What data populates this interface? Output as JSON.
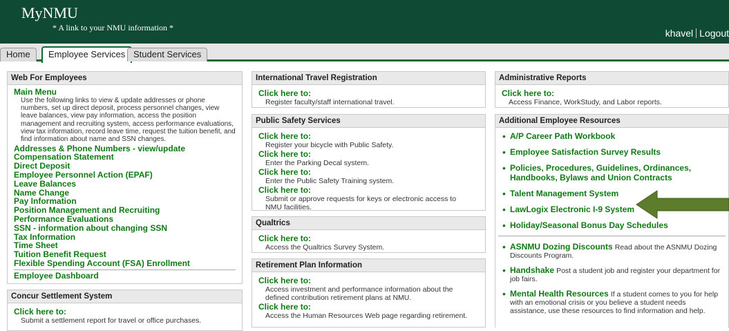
{
  "header": {
    "logo": "MyNMU",
    "tagline": "* A link to your NMU information *",
    "username": "khavel",
    "logout": "Logout"
  },
  "tabs": [
    {
      "label": "Home"
    },
    {
      "label": "Employee Services"
    },
    {
      "label": "Student Services"
    }
  ],
  "web_employees": {
    "title": "Web For Employees",
    "main_menu": "Main Menu",
    "main_menu_desc": "Use the following links to view & update addresses or phone numbers, set up direct deposit, process personnel changes, view leave balances, view pay information, access the position management and recruiting system, access performance evaluations, view tax information, record leave time, request the tuition benefit, and find information about name and SSN changes.",
    "links": [
      "Addresses & Phone Numbers - view/update",
      "Compensation Statement",
      "Direct Deposit",
      "Employee Personnel Action (EPAF)",
      "Leave Balances",
      "Name Change",
      "Pay Information",
      "Position Management and Recruiting",
      "Performance Evaluations",
      "SSN - information about changing SSN",
      "Tax Information",
      "Time Sheet",
      "Tuition Benefit Request",
      "Flexible Spending Account (FSA) Enrollment"
    ],
    "dashboard": "Employee Dashboard"
  },
  "concur": {
    "title": "Concur Settlement System",
    "link": "Click here to:",
    "desc": "Submit a settlement report for travel or office purchases."
  },
  "travel": {
    "title": "International Travel Registration",
    "link": "Click here to:",
    "desc": "Register faculty/staff international travel."
  },
  "safety": {
    "title": "Public Safety Services",
    "items": [
      {
        "link": "Click here to:",
        "desc": "Register your bicycle with Public Safety."
      },
      {
        "link": "Click here to:",
        "desc": "Enter the Parking Decal system."
      },
      {
        "link": "Click here to:",
        "desc": "Enter the Public Safety Training system."
      },
      {
        "link": "Click here to:",
        "desc": "Submit or approve requests for keys or electronic access to NMU facilities."
      }
    ]
  },
  "qualtrics": {
    "title": "Qualtrics",
    "link": "Click here to:",
    "desc": "Access the Qualtrics Survey System."
  },
  "retirement": {
    "title": "Retirement Plan Information",
    "items": [
      {
        "link": "Click here to:",
        "desc": "Access investment and performance information about the defined contribution retirement plans at NMU."
      },
      {
        "link": "Click here to:",
        "desc": "Access the Human Resources Web page regarding retirement."
      }
    ]
  },
  "admin": {
    "title": "Administrative Reports",
    "link": "Click here to:",
    "desc": "Access Finance, WorkStudy, and Labor reports."
  },
  "additional": {
    "title": "Additional Employee Resources",
    "links": [
      "A/P Career Path Workbook",
      "Employee Satisfaction Survey Results",
      "Policies, Procedures, Guidelines, Ordinances, Handbooks, Bylaws and Union Contracts",
      "Talent Management System",
      "LawLogix Electronic I-9 System",
      "Holiday/Seasonal Bonus Day Schedules"
    ],
    "student": [
      {
        "link": "ASNMU Dozing Discounts",
        "desc": "Read about the ASNMU Dozing Discounts Program."
      },
      {
        "link": "Handshake",
        "desc": "Post a student job and register your department for job fairs."
      },
      {
        "link": "Mental Health Resources",
        "desc": "If a student comes to you for help with an emotional crisis or you believe a student needs assistance, use these resources to find information and help."
      }
    ]
  },
  "colors": {
    "header": "#0e4a34",
    "link": "#0f7a14",
    "arrow": "#5d7d2c"
  }
}
